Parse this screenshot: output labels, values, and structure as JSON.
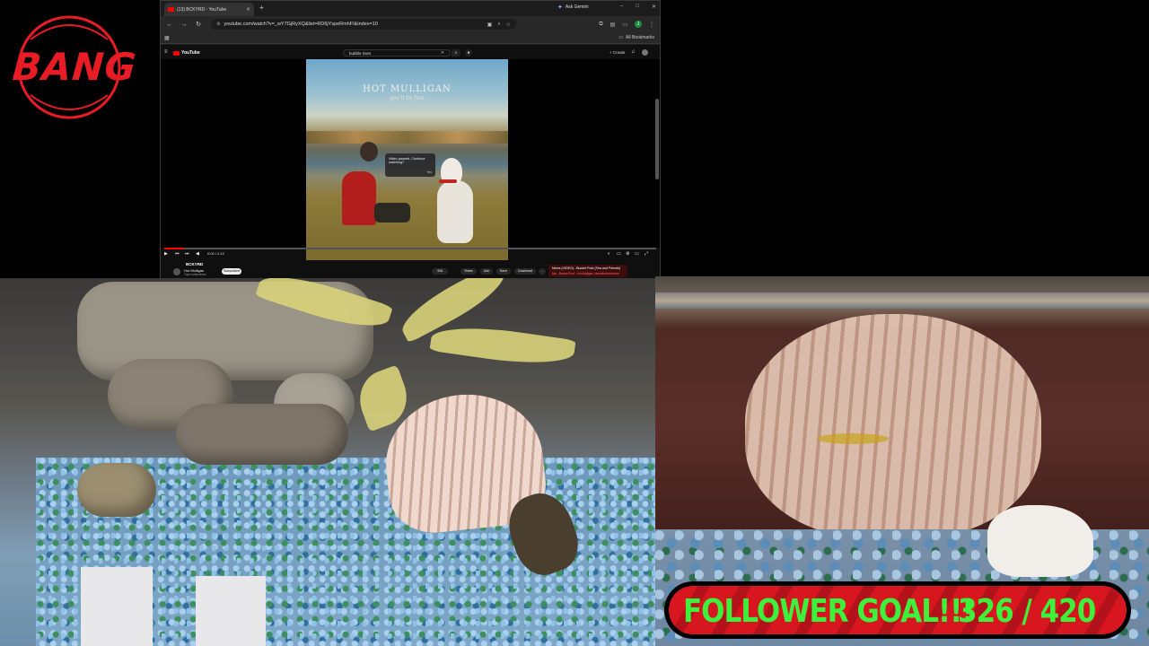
{
  "overlay": {
    "logo_text": "BANG",
    "logo_color": "#e81c24",
    "follower_goal": {
      "label": "FOLLOWER GOAL!!!",
      "current": 326,
      "target": 420,
      "count_text": "326 / 420",
      "text_color": "#3cf03c",
      "bar_color": "#d8161f"
    }
  },
  "browser": {
    "tab_title": "(13) BCKYRD - YouTube",
    "new_tab": "+",
    "ask_gemini": "Ask Gemini",
    "url": "youtube.com/watch?v=_wY7GjRyXQ&list=RD6jYspeRmhFI&index=10",
    "all_bookmarks": "All Bookmarks",
    "window_controls": [
      "–",
      "□",
      "✕"
    ]
  },
  "youtube": {
    "logo_text": "YouTube",
    "search_query": "bubble rises",
    "create_label": "+ Create",
    "album_title": "HOT MULLIGAN",
    "album_subtitle": "you'll be fine",
    "tooltip_text": "Video paused. Continue watching?",
    "tooltip_action": "Yes",
    "time": "0:00 / 2:12",
    "progress": 0.04,
    "video_title": "BCKYRD",
    "channel": "Hot Mulligan",
    "subscribers": "Topic subscribers",
    "subscribe_label": "Subscribed",
    "actions": [
      "306",
      "Share",
      "Ask",
      "Save",
      "Download",
      "…"
    ],
    "mix_title": "Mixes (VIDEO) - Bucket Post (Sha and Friends)",
    "mix_sub": "Mix - Bucket Post - Hot Mulligan, cancelled and more"
  }
}
